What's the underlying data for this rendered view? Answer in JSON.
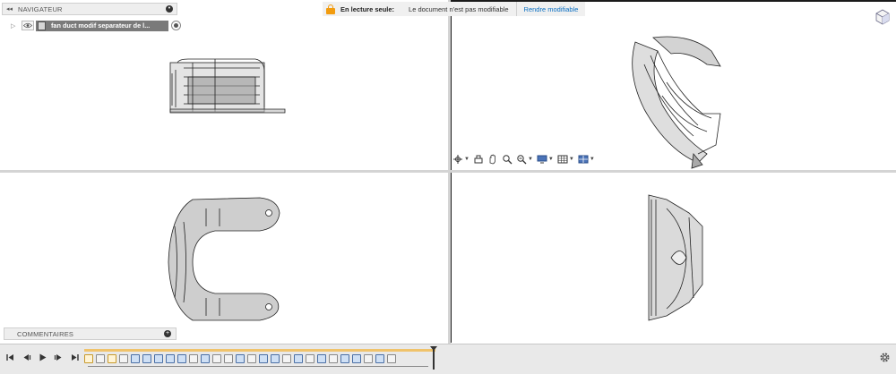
{
  "navigator": {
    "title": "NAVIGATEUR",
    "document_name": "fan duct modif separateur de l..."
  },
  "readonly_banner": {
    "label": "En lecture seule:",
    "message": "Le document n'est pas modifiable",
    "action": "Rendre modifiable"
  },
  "comments": {
    "title": "COMMENTAIRES"
  },
  "colors": {
    "lock": "#f29c0f",
    "link": "#0a6fc2",
    "timeline_bar": "#f0c36b"
  },
  "icons": {
    "navbar": [
      "orbit-icon",
      "look-at-icon",
      "pan-icon",
      "zoom-icon",
      "fit-icon",
      "display-settings-icon",
      "grid-icon",
      "viewports-icon"
    ],
    "playback": [
      "skip-start-icon",
      "step-back-icon",
      "play-icon",
      "step-forward-icon",
      "skip-end-icon"
    ]
  }
}
